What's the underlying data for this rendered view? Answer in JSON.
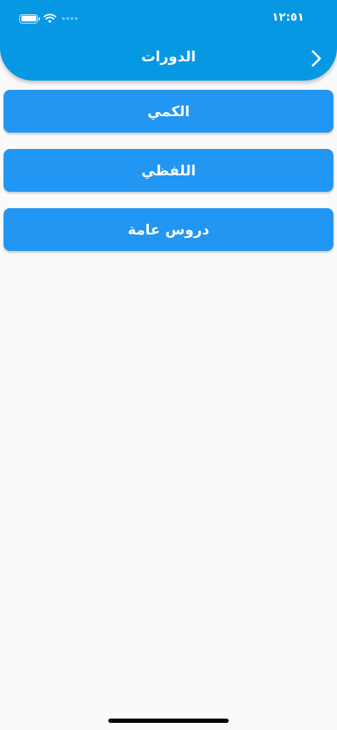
{
  "status_bar": {
    "time": "١٢:٥١"
  },
  "app_bar": {
    "title": "الدورات",
    "background_color": "#0798e4",
    "back_icon": "chevron-right-icon"
  },
  "courses": [
    {
      "label": "الكمي"
    },
    {
      "label": "اللفظي"
    },
    {
      "label": "دروس عامة"
    }
  ],
  "colors": {
    "button": "#2196f3",
    "page_background": "#fafafa"
  }
}
